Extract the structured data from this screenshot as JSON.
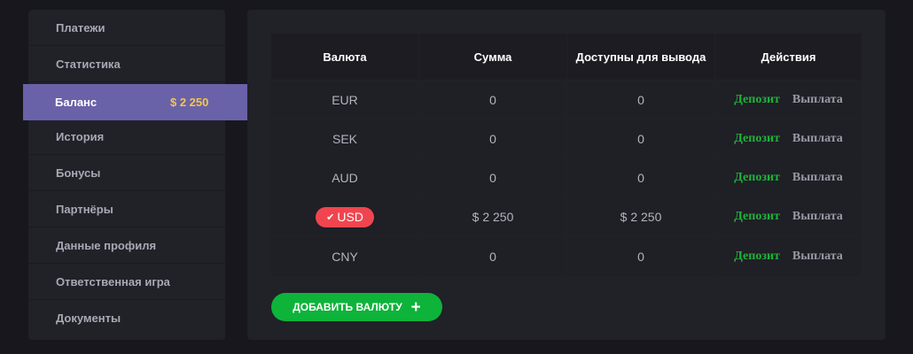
{
  "sidebar": {
    "items": [
      {
        "label": "Платежи"
      },
      {
        "label": "Статистика"
      },
      {
        "label": "Баланс",
        "amount": "$ 2 250",
        "active": true
      },
      {
        "label": "История"
      },
      {
        "label": "Бонусы"
      },
      {
        "label": "Партнёры"
      },
      {
        "label": "Данные профиля"
      },
      {
        "label": "Ответственная игра"
      },
      {
        "label": "Документы"
      }
    ]
  },
  "table": {
    "headers": [
      "Валюта",
      "Сумма",
      "Доступны для вывода",
      "Действия"
    ],
    "rows": [
      {
        "currency": "EUR",
        "sum": "0",
        "available": "0",
        "deposit": "Депозит",
        "withdraw": "Выплата"
      },
      {
        "currency": "SEK",
        "sum": "0",
        "available": "0",
        "deposit": "Депозит",
        "withdraw": "Выплата"
      },
      {
        "currency": "AUD",
        "sum": "0",
        "available": "0",
        "deposit": "Депозит",
        "withdraw": "Выплата"
      },
      {
        "currency": "USD",
        "sum": "$ 2 250",
        "available": "$ 2 250",
        "deposit": "Депозит",
        "withdraw": "Выплата",
        "selected": true
      },
      {
        "currency": "CNY",
        "sum": "0",
        "available": "0",
        "deposit": "Депозит",
        "withdraw": "Выплата"
      }
    ]
  },
  "add_currency_button": {
    "label": "ДОБАВИТЬ ВАЛЮТУ",
    "icon": "plus-icon"
  },
  "colors": {
    "accent": "#6962a9",
    "balance_amount": "#f5c64a",
    "deposit": "#1eb33a",
    "selected_badge": "#f0454f",
    "add_button": "#0eb33a"
  }
}
